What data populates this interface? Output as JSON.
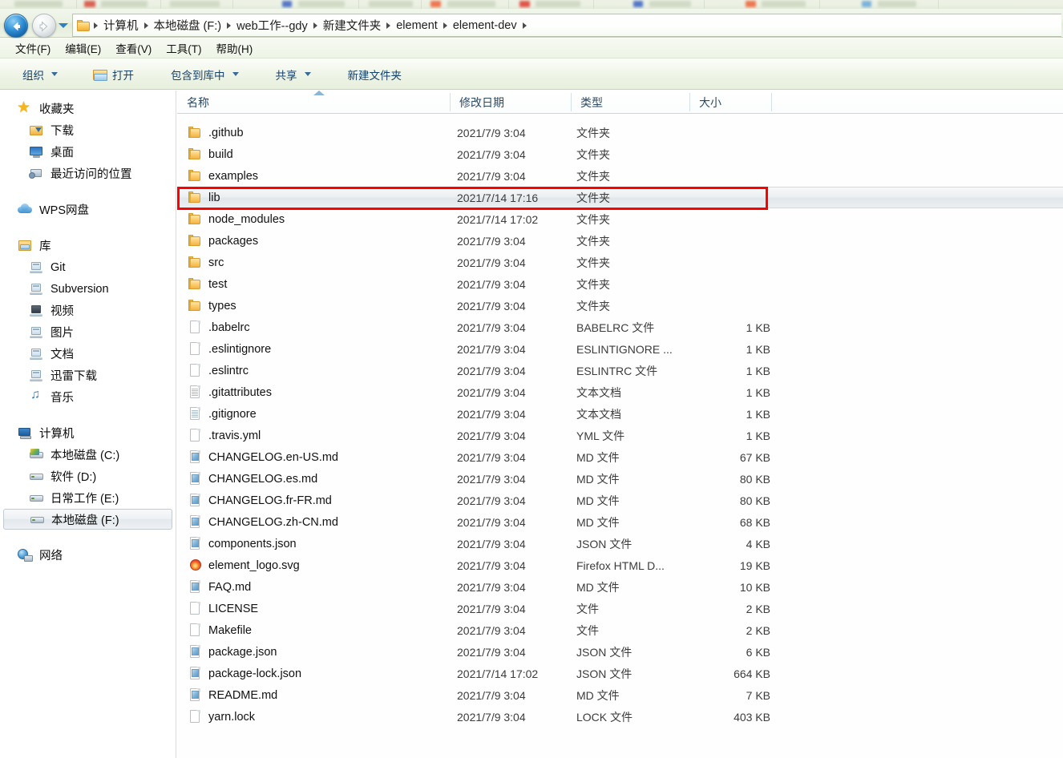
{
  "window": {
    "title": "element-dev",
    "top_strip_note": "blurred browser tab bar"
  },
  "nav": {
    "back_label": "后退",
    "forward_label": "前进",
    "recent_dropdown_label": "最近的位置",
    "breadcrumb": [
      "计算机",
      "本地磁盘 (F:)",
      "web工作--gdy",
      "新建文件夹",
      "element",
      "element-dev"
    ]
  },
  "menubar": {
    "items": [
      "文件(F)",
      "编辑(E)",
      "查看(V)",
      "工具(T)",
      "帮助(H)"
    ]
  },
  "toolbar": {
    "items": [
      {
        "label": "组织",
        "caret": true,
        "icon": "none"
      },
      {
        "label": "打开",
        "caret": false,
        "icon": "open-folder-icon"
      },
      {
        "label": "包含到库中",
        "caret": true,
        "icon": "none"
      },
      {
        "label": "共享",
        "caret": true,
        "icon": "none"
      },
      {
        "label": "新建文件夹",
        "caret": false,
        "icon": "none"
      }
    ]
  },
  "sidebar": {
    "groups": [
      {
        "header": {
          "label": "收藏夹",
          "icon": "star-icon"
        },
        "items": [
          {
            "label": "下载",
            "icon": "download-folder-icon"
          },
          {
            "label": "桌面",
            "icon": "desktop-monitor-icon"
          },
          {
            "label": "最近访问的位置",
            "icon": "recent-places-icon"
          }
        ]
      },
      {
        "header": {
          "label": "WPS网盘",
          "icon": "cloud-icon"
        },
        "items": []
      },
      {
        "header": {
          "label": "库",
          "icon": "library-icon"
        },
        "items": [
          {
            "label": "Git",
            "icon": "library-folder-icon"
          },
          {
            "label": "Subversion",
            "icon": "library-folder-icon"
          },
          {
            "label": "视频",
            "icon": "video-library-icon"
          },
          {
            "label": "图片",
            "icon": "pictures-library-icon"
          },
          {
            "label": "文档",
            "icon": "documents-library-icon"
          },
          {
            "label": "迅雷下载",
            "icon": "library-folder-icon"
          },
          {
            "label": "音乐",
            "icon": "music-note-icon"
          }
        ]
      },
      {
        "header": {
          "label": "计算机",
          "icon": "computer-icon"
        },
        "items": [
          {
            "label": "本地磁盘 (C:)",
            "icon": "system-drive-icon",
            "selected": false
          },
          {
            "label": "软件 (D:)",
            "icon": "drive-icon",
            "selected": false
          },
          {
            "label": "日常工作 (E:)",
            "icon": "drive-icon",
            "selected": false
          },
          {
            "label": "本地磁盘 (F:)",
            "icon": "drive-icon",
            "selected": true
          }
        ]
      },
      {
        "header": {
          "label": "网络",
          "icon": "network-globe-icon"
        },
        "items": []
      }
    ]
  },
  "filelist": {
    "columns": [
      {
        "key": "name",
        "label": "名称",
        "sorted": "asc"
      },
      {
        "key": "date",
        "label": "修改日期"
      },
      {
        "key": "type",
        "label": "类型"
      },
      {
        "key": "size",
        "label": "大小"
      }
    ],
    "rows": [
      {
        "name": ".github",
        "date": "2021/7/9 3:04",
        "type": "文件夹",
        "size": "",
        "icon": "folder-icon",
        "selected": false
      },
      {
        "name": "build",
        "date": "2021/7/9 3:04",
        "type": "文件夹",
        "size": "",
        "icon": "folder-icon",
        "selected": false
      },
      {
        "name": "examples",
        "date": "2021/7/9 3:04",
        "type": "文件夹",
        "size": "",
        "icon": "folder-icon",
        "selected": false
      },
      {
        "name": "lib",
        "date": "2021/7/14 17:16",
        "type": "文件夹",
        "size": "",
        "icon": "folder-icon",
        "selected": true
      },
      {
        "name": "node_modules",
        "date": "2021/7/14 17:02",
        "type": "文件夹",
        "size": "",
        "icon": "folder-icon",
        "selected": false
      },
      {
        "name": "packages",
        "date": "2021/7/9 3:04",
        "type": "文件夹",
        "size": "",
        "icon": "folder-icon",
        "selected": false
      },
      {
        "name": "src",
        "date": "2021/7/9 3:04",
        "type": "文件夹",
        "size": "",
        "icon": "folder-icon",
        "selected": false
      },
      {
        "name": "test",
        "date": "2021/7/9 3:04",
        "type": "文件夹",
        "size": "",
        "icon": "folder-icon",
        "selected": false
      },
      {
        "name": "types",
        "date": "2021/7/9 3:04",
        "type": "文件夹",
        "size": "",
        "icon": "folder-icon",
        "selected": false
      },
      {
        "name": ".babelrc",
        "date": "2021/7/9 3:04",
        "type": "BABELRC 文件",
        "size": "1 KB",
        "icon": "blank-file-icon",
        "selected": false
      },
      {
        "name": ".eslintignore",
        "date": "2021/7/9 3:04",
        "type": "ESLINTIGNORE ...",
        "size": "1 KB",
        "icon": "blank-file-icon",
        "selected": false
      },
      {
        "name": ".eslintrc",
        "date": "2021/7/9 3:04",
        "type": "ESLINTRC 文件",
        "size": "1 KB",
        "icon": "blank-file-icon",
        "selected": false
      },
      {
        "name": ".gitattributes",
        "date": "2021/7/9 3:04",
        "type": "文本文档",
        "size": "1 KB",
        "icon": "text-file-icon",
        "selected": false
      },
      {
        "name": ".gitignore",
        "date": "2021/7/9 3:04",
        "type": "文本文档",
        "size": "1 KB",
        "icon": "text-file-icon",
        "selected": false
      },
      {
        "name": ".travis.yml",
        "date": "2021/7/9 3:04",
        "type": "YML 文件",
        "size": "1 KB",
        "icon": "blank-file-icon",
        "selected": false
      },
      {
        "name": "CHANGELOG.en-US.md",
        "date": "2021/7/9 3:04",
        "type": "MD 文件",
        "size": "67 KB",
        "icon": "blue-doc-icon",
        "selected": false
      },
      {
        "name": "CHANGELOG.es.md",
        "date": "2021/7/9 3:04",
        "type": "MD 文件",
        "size": "80 KB",
        "icon": "blue-doc-icon",
        "selected": false
      },
      {
        "name": "CHANGELOG.fr-FR.md",
        "date": "2021/7/9 3:04",
        "type": "MD 文件",
        "size": "80 KB",
        "icon": "blue-doc-icon",
        "selected": false
      },
      {
        "name": "CHANGELOG.zh-CN.md",
        "date": "2021/7/9 3:04",
        "type": "MD 文件",
        "size": "68 KB",
        "icon": "blue-doc-icon",
        "selected": false
      },
      {
        "name": "components.json",
        "date": "2021/7/9 3:04",
        "type": "JSON 文件",
        "size": "4 KB",
        "icon": "blue-doc-icon",
        "selected": false
      },
      {
        "name": "element_logo.svg",
        "date": "2021/7/9 3:04",
        "type": "Firefox HTML D...",
        "size": "19 KB",
        "icon": "firefox-icon",
        "selected": false
      },
      {
        "name": "FAQ.md",
        "date": "2021/7/9 3:04",
        "type": "MD 文件",
        "size": "10 KB",
        "icon": "blue-doc-icon",
        "selected": false
      },
      {
        "name": "LICENSE",
        "date": "2021/7/9 3:04",
        "type": "文件",
        "size": "2 KB",
        "icon": "blank-file-icon",
        "selected": false
      },
      {
        "name": "Makefile",
        "date": "2021/7/9 3:04",
        "type": "文件",
        "size": "2 KB",
        "icon": "blank-file-icon",
        "selected": false
      },
      {
        "name": "package.json",
        "date": "2021/7/9 3:04",
        "type": "JSON 文件",
        "size": "6 KB",
        "icon": "blue-doc-icon",
        "selected": false
      },
      {
        "name": "package-lock.json",
        "date": "2021/7/14 17:02",
        "type": "JSON 文件",
        "size": "664 KB",
        "icon": "blue-doc-icon",
        "selected": false
      },
      {
        "name": "README.md",
        "date": "2021/7/9 3:04",
        "type": "MD 文件",
        "size": "7 KB",
        "icon": "blue-doc-icon",
        "selected": false
      },
      {
        "name": "yarn.lock",
        "date": "2021/7/9 3:04",
        "type": "LOCK 文件",
        "size": "403 KB",
        "icon": "blank-file-icon",
        "selected": false
      }
    ]
  },
  "annotation": {
    "highlight_color": "#ff0000",
    "target_row_name": "lib"
  },
  "colors": {
    "chrome_green": "#eaf1e1",
    "folder_yellow": "#f3b443",
    "selection_gray": "#e3e8ec",
    "header_text": "#2b4a66"
  }
}
